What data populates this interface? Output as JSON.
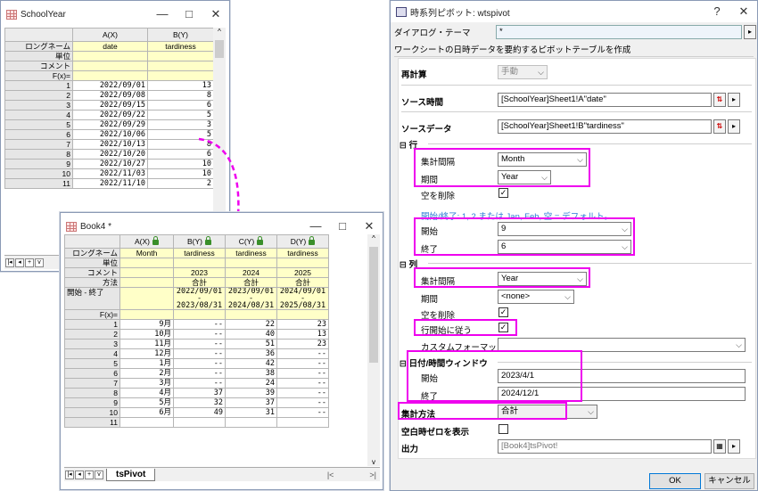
{
  "schoolyear": {
    "title": "SchoolYear",
    "controls": [
      "—",
      "□",
      "✕"
    ],
    "col_headers": [
      "A(X)",
      "B(Y)"
    ],
    "row_labels": [
      "ロングネーム",
      "単位",
      "コメント",
      "F(x)="
    ],
    "longnames": [
      "date",
      "tardiness"
    ],
    "rows": [
      [
        "1",
        "2022/09/01",
        "13"
      ],
      [
        "2",
        "2022/09/08",
        "8"
      ],
      [
        "3",
        "2022/09/15",
        "6"
      ],
      [
        "4",
        "2022/09/22",
        "5"
      ],
      [
        "5",
        "2022/09/29",
        "3"
      ],
      [
        "6",
        "2022/10/06",
        "5"
      ],
      [
        "7",
        "2022/10/13",
        "8"
      ],
      [
        "8",
        "2022/10/20",
        "6"
      ],
      [
        "9",
        "2022/10/27",
        "10"
      ],
      [
        "10",
        "2022/11/03",
        "10"
      ],
      [
        "11",
        "2022/11/10",
        "2"
      ]
    ]
  },
  "book4": {
    "title": "Book4 *",
    "controls": [
      "—",
      "□",
      "✕"
    ],
    "col_headers": [
      "A(X)",
      "B(Y)",
      "C(Y)",
      "D(Y)"
    ],
    "row_labels": [
      "ロングネーム",
      "単位",
      "コメント",
      "方法",
      "開始 - 終了",
      "F(x)="
    ],
    "longnames": [
      "Month",
      "tardiness",
      "tardiness",
      "tardiness"
    ],
    "comments": [
      "",
      "2023",
      "2024",
      "2025"
    ],
    "methods": [
      "",
      "合計",
      "合計",
      "合計"
    ],
    "ranges": [
      [
        "",
        ""
      ],
      [
        "2022/09/01",
        "2023/08/31"
      ],
      [
        "2023/09/01",
        "2024/08/31"
      ],
      [
        "2024/09/01",
        "2025/08/31"
      ]
    ],
    "range_dash": "-",
    "rows": [
      [
        "1",
        "9月",
        "--",
        "22",
        "23"
      ],
      [
        "2",
        "10月",
        "--",
        "40",
        "13"
      ],
      [
        "3",
        "11月",
        "--",
        "51",
        "23"
      ],
      [
        "4",
        "12月",
        "--",
        "36",
        "--"
      ],
      [
        "5",
        "1月",
        "--",
        "42",
        "--"
      ],
      [
        "6",
        "2月",
        "--",
        "38",
        "--"
      ],
      [
        "7",
        "3月",
        "--",
        "24",
        "--"
      ],
      [
        "8",
        "4月",
        "37",
        "39",
        "--"
      ],
      [
        "9",
        "5月",
        "32",
        "37",
        "--"
      ],
      [
        "10",
        "6月",
        "49",
        "31",
        "--"
      ],
      [
        "11",
        "",
        "",
        "",
        ""
      ]
    ],
    "tab": "tsPivot"
  },
  "dialog": {
    "title": "時系列ピボット: wtspivot",
    "help": "?",
    "close": "✕",
    "theme_label": "ダイアログ・テーマ",
    "theme_value": "*",
    "description": "ワークシートの日時データを要約するピボットテーブルを作成",
    "recalc_label": "再計算",
    "recalc_value": "手動",
    "source_time_label": "ソース時間",
    "source_time_value": "[SchoolYear]Sheet1!A\"date\"",
    "source_data_label": "ソースデータ",
    "source_data_value": "[SchoolYear]Sheet1!B\"tardiness\"",
    "row_section": "行",
    "row_interval_label": "集計間隔",
    "row_interval_value": "Month",
    "row_period_label": "期間",
    "row_period_value": "Year",
    "row_remove_empty_label": "空を削除",
    "hint": "開始/終了: 1, 2 または Jan, Feb, 空 = デフォルト。",
    "start_label": "開始",
    "start_value": "9",
    "end_label": "終了",
    "end_value": "6",
    "col_section": "列",
    "col_interval_label": "集計間隔",
    "col_interval_value": "Year",
    "col_period_label": "期間",
    "col_period_value": "<none>",
    "col_remove_empty_label": "空を削除",
    "col_follow_label": "行開始に従う",
    "custom_format_label": "カスタムフォーマット",
    "custom_format_value": "",
    "window_section": "日付/時間ウィンドウ",
    "win_start_label": "開始",
    "win_start_value": "2023/4/1",
    "win_end_label": "終了",
    "win_end_value": "2024/12/1",
    "agg_label": "集計方法",
    "agg_value": "合計",
    "zero_label": "空白時ゼロを表示",
    "output_label": "出力",
    "output_value": "[Book4]tsPivot!",
    "ok": "OK",
    "cancel": "キャンセル",
    "collapse_glyph": "⊟"
  },
  "colors": {
    "highlight": "#ee00ee",
    "arrow": "#ee00ee",
    "yellow": "#ffffc8"
  }
}
